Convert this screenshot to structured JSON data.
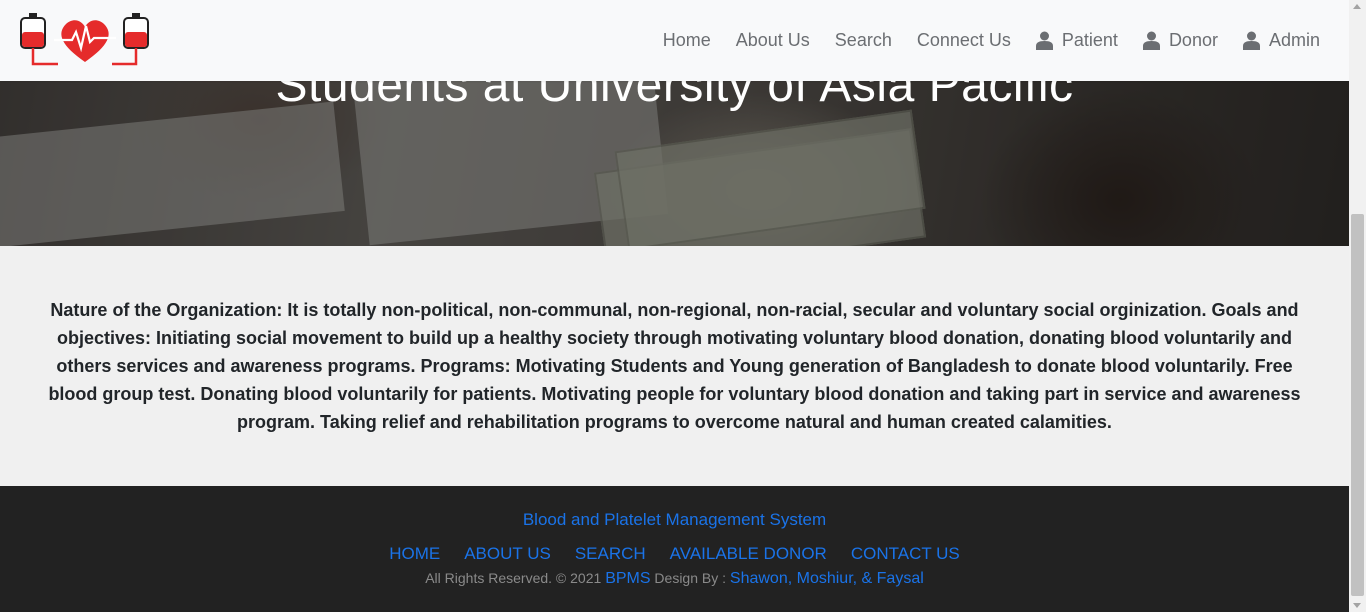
{
  "nav": {
    "items": [
      {
        "label": "Home"
      },
      {
        "label": "About Us"
      },
      {
        "label": "Search"
      },
      {
        "label": "Connect Us"
      },
      {
        "label": "Patient",
        "icon": "user-icon"
      },
      {
        "label": "Donor",
        "icon": "user-icon"
      },
      {
        "label": "Admin",
        "icon": "user-icon"
      }
    ]
  },
  "logo": {
    "icon": "blood-bag-heartbeat-logo",
    "color": "#e52b2b"
  },
  "hero": {
    "title": "Students at University of Asia Pacific"
  },
  "content": {
    "text": "Nature of the Organization: It is totally non-political, non-communal, non-regional, non-racial, secular and voluntary social orginization. Goals and objectives: Initiating social movement to build up a healthy society through motivating voluntary blood donation, donating blood voluntarily and others services and awareness programs. Programs: Motivating Students and Young generation of Bangladesh to donate blood voluntarily. Free blood group test. Donating blood voluntarily for patients. Motivating people for voluntary blood donation and taking part in service and awareness program. Taking relief and rehabilitation programs to overcome natural and human created calamities."
  },
  "footer": {
    "title": "Blood and Platelet Management System",
    "links": [
      {
        "label": "HOME"
      },
      {
        "label": "ABOUT US"
      },
      {
        "label": "SEARCH"
      },
      {
        "label": "AVAILABLE DONOR"
      },
      {
        "label": "CONTACT US"
      }
    ],
    "copyright": "All Rights Reserved. © 2021",
    "brand": "BPMS",
    "design_by": "Design By :",
    "authors": "Shawon, Moshiur, & Faysal"
  },
  "colors": {
    "link": "#1a73e8",
    "footer_bg": "#222222",
    "nav_text": "#6b6e72"
  }
}
